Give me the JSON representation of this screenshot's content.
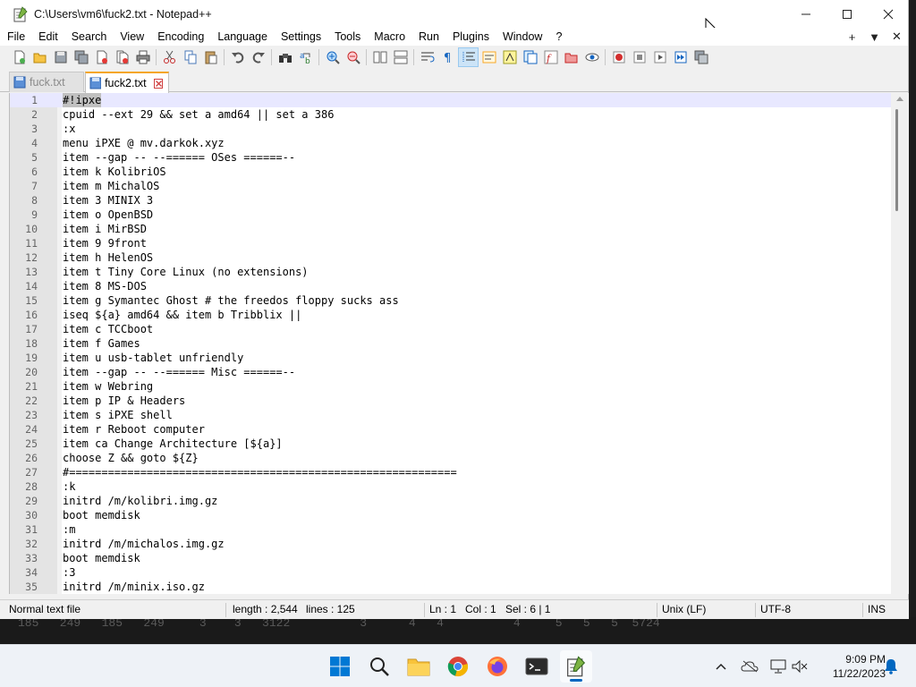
{
  "window": {
    "title": "C:\\Users\\vm6\\fuck2.txt - Notepad++"
  },
  "menu": [
    "File",
    "Edit",
    "Search",
    "View",
    "Encoding",
    "Language",
    "Settings",
    "Tools",
    "Macro",
    "Run",
    "Plugins",
    "Window",
    "?"
  ],
  "menu_right": {
    "plus": "+",
    "down": "▼",
    "close": "✕"
  },
  "tabs": [
    {
      "label": "fuck.txt",
      "active": false
    },
    {
      "label": "fuck2.txt",
      "active": true
    }
  ],
  "editor": {
    "lines": [
      "#!ipxe",
      "cpuid --ext 29 && set a amd64 || set a 386",
      ":x",
      "menu iPXE @ mv.darkok.xyz",
      "item --gap -- --====== OSes ======--",
      "item k KolibriOS",
      "item m MichalOS",
      "item 3 MINIX 3",
      "item o OpenBSD",
      "item i MirBSD",
      "item 9 9front",
      "item h HelenOS",
      "item t Tiny Core Linux (no extensions)",
      "item 8 MS-DOS",
      "item g Symantec Ghost # the freedos floppy sucks ass",
      "iseq ${a} amd64 && item b Tribblix ||",
      "item c TCCboot",
      "item f Games",
      "item u usb-tablet unfriendly",
      "item --gap -- --====== Misc ======--",
      "item w Webring",
      "item p IP & Headers",
      "item s iPXE shell",
      "item r Reboot computer",
      "item ca Change Architecture [${a}]",
      "choose Z && goto ${Z}",
      "#============================================================",
      ":k",
      "initrd /m/kolibri.img.gz",
      "boot memdisk",
      ":m",
      "initrd /m/michalos.img.gz",
      "boot memdisk",
      ":3",
      "initrd /m/minix.iso.gz"
    ],
    "current_line": 1
  },
  "status": {
    "file_type": "Normal text file",
    "length": "length : 2,544",
    "lines": "lines : 125",
    "ln": "Ln : 1",
    "col": "Col : 1",
    "sel": "Sel : 6 | 1",
    "eol": "Unix (LF)",
    "encoding": "UTF-8",
    "mode": "INS"
  },
  "desktop_text": "185   249   185   249     3    3   3122          3      4   4          4     5   5   5  5724",
  "taskbar": {
    "time": "9:09 PM",
    "date": "11/22/2023"
  },
  "colors": {
    "accent": "#0067c0",
    "active_tab": "#f5a623",
    "current_line": "#e8e8ff"
  }
}
